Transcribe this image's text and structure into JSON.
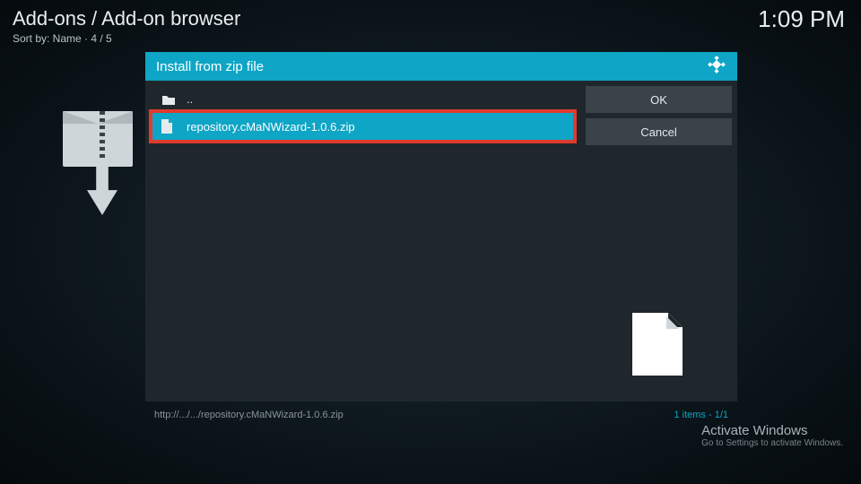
{
  "header": {
    "title": "Add-ons / Add-on browser",
    "subtitle": "Sort by: Name  · 4 / 5"
  },
  "clock": "1:09 PM",
  "dialog": {
    "title": "Install from zip file",
    "parent_label": "..",
    "file_label": "repository.cMaNWizard-1.0.6.zip",
    "ok_label": "OK",
    "cancel_label": "Cancel",
    "path_text": "http://.../.../repository.cMaNWizard-1.0.6.zip",
    "items_text": "1 items - 1/1"
  },
  "watermark": {
    "title": "Activate Windows",
    "sub": "Go to Settings to activate Windows."
  }
}
